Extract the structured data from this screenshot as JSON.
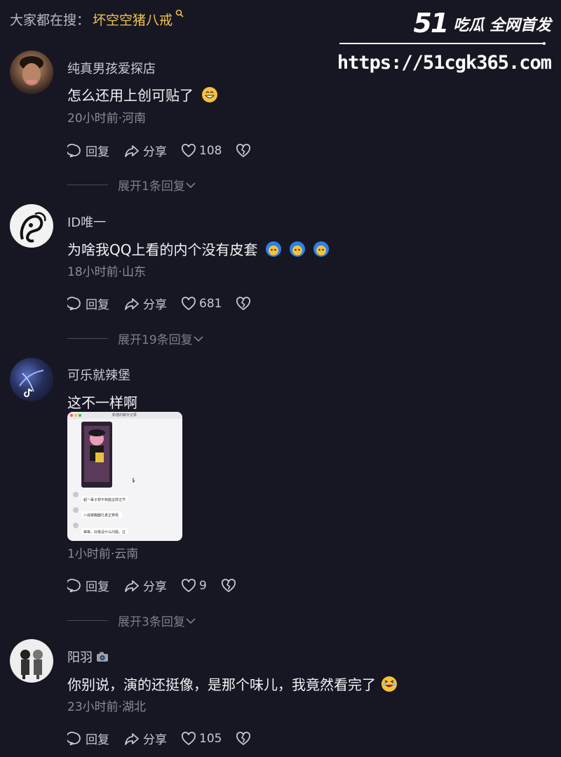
{
  "search": {
    "prefix": "大家都在搜：",
    "term": "坏空空猪八戒"
  },
  "watermark": {
    "logo_number": "51",
    "slogan": "吃瓜 全网首发",
    "url": "https://51cgk365.com"
  },
  "actions": {
    "reply": "回复",
    "share": "分享"
  },
  "comments": [
    {
      "username": "纯真男孩爱探店",
      "text": "怎么还用上创可贴了",
      "meta": "20小时前·河南",
      "likes": "108",
      "expand": "展开1条回复"
    },
    {
      "username": "ID唯一",
      "text": "为啥我QQ上看的内个没有皮套",
      "meta": "18小时前·山东",
      "likes": "681",
      "expand": "展开19条回复"
    },
    {
      "username": "可乐就辣堡",
      "text": "这不一样啊",
      "meta": "1小时前·云南",
      "likes": "9",
      "expand": "展开3条回复",
      "image": {
        "title": "新建的聊天记录",
        "msg1": "超一辈子想不到能这样过节",
        "msg2": "八戒被胸器孔真正笑呢",
        "msg3": "等等，好像没什么问题，过"
      }
    },
    {
      "username": "阳羽",
      "text": "你别说，演的还挺像，是那个味儿，我竟然看完了",
      "meta": "23小时前·湖北",
      "likes": "105"
    }
  ]
}
